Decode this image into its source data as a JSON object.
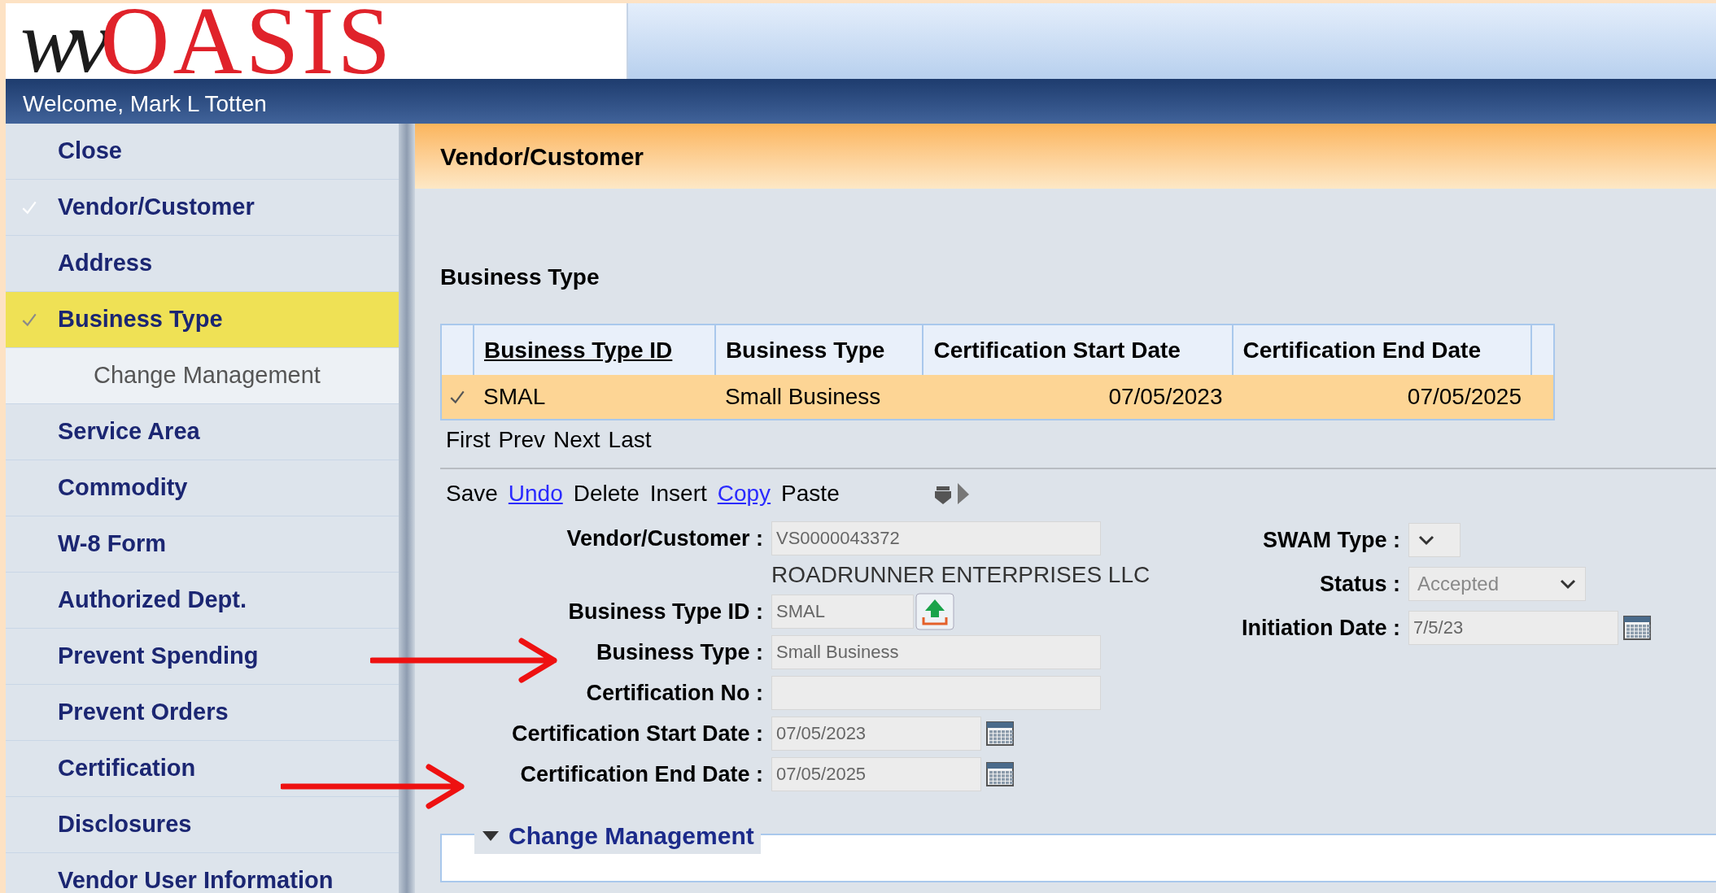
{
  "logo": {
    "prefix": "wv",
    "name": "OASIS"
  },
  "welcome": "Welcome, Mark L Totten",
  "sidebar": {
    "items": [
      {
        "label": "Close",
        "checked": false,
        "selected": false
      },
      {
        "label": "Vendor/Customer",
        "checked": true,
        "selected": false
      },
      {
        "label": "Address",
        "checked": false,
        "selected": false
      },
      {
        "label": "Business Type",
        "checked": true,
        "selected": true,
        "children": [
          {
            "label": "Change Management",
            "selected": false
          }
        ]
      },
      {
        "label": "Service Area",
        "checked": false,
        "selected": false
      },
      {
        "label": "Commodity",
        "checked": false,
        "selected": false
      },
      {
        "label": "W-8 Form",
        "checked": false,
        "selected": false
      },
      {
        "label": "Authorized Dept.",
        "checked": false,
        "selected": false
      },
      {
        "label": "Prevent Spending",
        "checked": false,
        "selected": false
      },
      {
        "label": "Prevent Orders",
        "checked": false,
        "selected": false
      },
      {
        "label": "Certification",
        "checked": false,
        "selected": false
      },
      {
        "label": "Disclosures",
        "checked": false,
        "selected": false
      },
      {
        "label": "Vendor User Information",
        "checked": false,
        "selected": false
      }
    ]
  },
  "page_title": "Vendor/Customer",
  "section_title": "Business Type",
  "table": {
    "columns": [
      {
        "label": "Business Type ID",
        "sortable": true
      },
      {
        "label": "Business Type",
        "sortable": false
      },
      {
        "label": "Certification Start Date",
        "sortable": false
      },
      {
        "label": "Certification End Date",
        "sortable": false
      }
    ],
    "rows": [
      {
        "selected": true,
        "checked": true,
        "cells": [
          "SMAL",
          "Small Business",
          "07/05/2023",
          "07/05/2025"
        ]
      }
    ]
  },
  "pager": [
    "First",
    "Prev",
    "Next",
    "Last"
  ],
  "toolbar": [
    {
      "label": "Save",
      "kind": "plain"
    },
    {
      "label": "Undo",
      "kind": "link"
    },
    {
      "label": "Delete",
      "kind": "plain"
    },
    {
      "label": "Insert",
      "kind": "plain"
    },
    {
      "label": "Copy",
      "kind": "link"
    },
    {
      "label": "Paste",
      "kind": "plain"
    }
  ],
  "form_left": [
    {
      "label": "Vendor/Customer :",
      "kind": "text",
      "value": "VS0000043372",
      "note": "ROADRUNNER ENTERPRISES LLC"
    },
    {
      "label": "Business Type ID :",
      "kind": "lookup",
      "value": "SMAL"
    },
    {
      "label": "Business Type :",
      "kind": "text",
      "value": "Small Business"
    },
    {
      "label": "Certification No :",
      "kind": "text"
    },
    {
      "label": "Certification Start Date :",
      "kind": "date",
      "value": "07/05/2023"
    },
    {
      "label": "Certification End Date :",
      "kind": "date",
      "value": "07/05/2025"
    }
  ],
  "form_right": [
    {
      "label": "SWAM Type :",
      "kind": "select"
    },
    {
      "label": "Status :",
      "kind": "select",
      "value": "Accepted"
    },
    {
      "label": "Initiation Date :",
      "kind": "date",
      "value": "7/5/23"
    }
  ],
  "change_management": {
    "title": "Change Management",
    "expanded": true
  }
}
